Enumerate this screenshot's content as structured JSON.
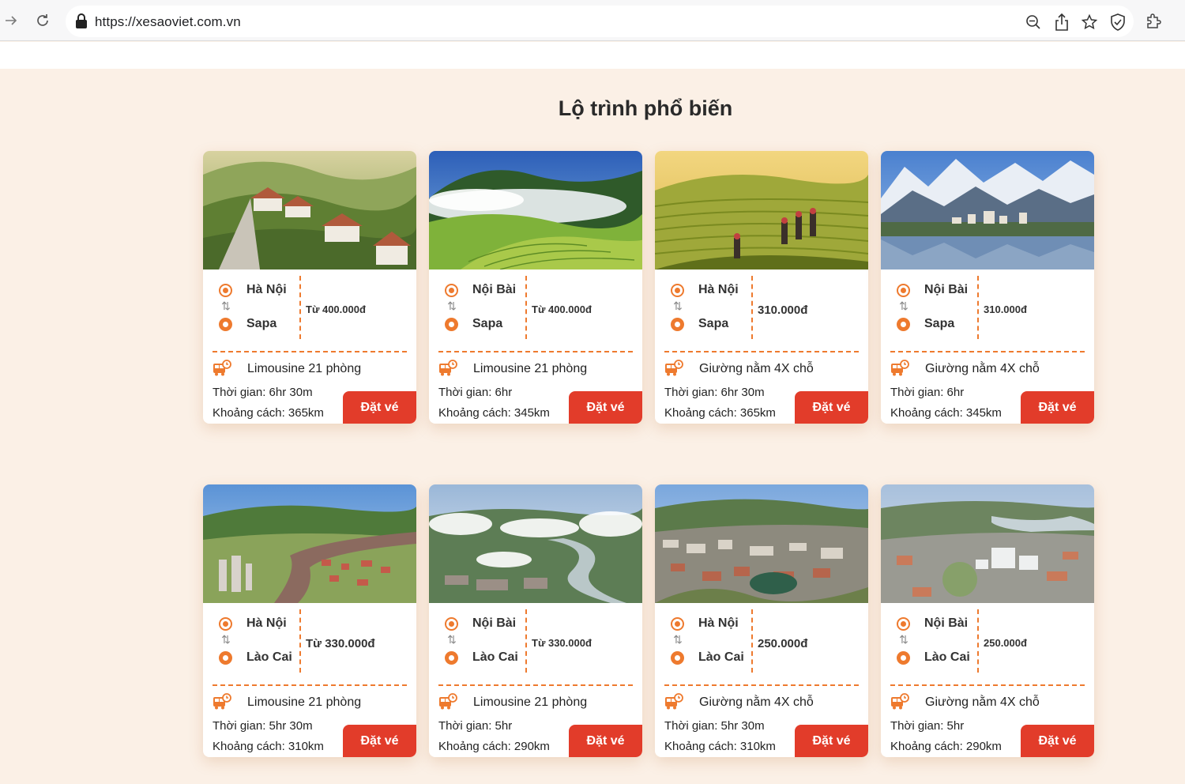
{
  "browser": {
    "url": "https://xesaoviet.com.vn",
    "icons": [
      "forward-icon",
      "reload-icon",
      "lock-icon",
      "zoom-out-icon",
      "share-icon",
      "bookmark-star-icon",
      "shield-icon",
      "extensions-icon"
    ]
  },
  "section": {
    "title": "Lộ trình phổ biến"
  },
  "colors": {
    "accent": "#ee7a2e",
    "button": "#e23c2a",
    "page_bg": "#fbf0e6"
  },
  "cards": [
    {
      "image": "mountain village with red-roof houses",
      "from": "Hà Nội",
      "to": "Sapa",
      "price": "Từ 400.000đ",
      "bus_type": "Limousine 21 phòng",
      "time": "Thời gian: 6hr 30m",
      "distance": "Khoảng cách: 365km",
      "button": "Đặt vé"
    },
    {
      "image": "misty green rice terraces",
      "from": "Nội Bài",
      "to": "Sapa",
      "price": "Từ 400.000đ",
      "bus_type": "Limousine 21 phòng",
      "time": "Thời gian: 6hr",
      "distance": "Khoảng cách: 345km",
      "button": "Đặt vé"
    },
    {
      "image": "golden rice terraces with hikers",
      "from": "Hà Nội",
      "to": "Sapa",
      "price": "310.000đ",
      "bus_type": "Giường nằm 4X chỗ",
      "time": "Thời gian: 6hr 30m",
      "distance": "Khoảng cách: 365km",
      "button": "Đặt vé"
    },
    {
      "image": "snowy mountains above lake town",
      "from": "Nội Bài",
      "to": "Sapa",
      "price": "310.000đ",
      "bus_type": "Giường nằm 4X chỗ",
      "time": "Thời gian: 6hr",
      "distance": "Khoảng cách: 345km",
      "button": "Đặt vé"
    },
    {
      "image": "aerial city with river",
      "from": "Hà Nội",
      "to": "Lào Cai",
      "price": "Từ 330.000đ",
      "bus_type": "Limousine 21 phòng",
      "time": "Thời gian: 5hr 30m",
      "distance": "Khoảng cách: 310km",
      "button": "Đặt vé"
    },
    {
      "image": "aerial city with clouds",
      "from": "Nội Bài",
      "to": "Lào Cai",
      "price": "Từ 330.000đ",
      "bus_type": "Limousine 21 phòng",
      "time": "Thời gian: 5hr",
      "distance": "Khoảng cách: 290km",
      "button": "Đặt vé"
    },
    {
      "image": "aerial dense city",
      "from": "Hà Nội",
      "to": "Lào Cai",
      "price": "250.000đ",
      "bus_type": "Giường nằm 4X chỗ",
      "time": "Thời gian: 5hr 30m",
      "distance": "Khoảng cách: 310km",
      "button": "Đặt vé"
    },
    {
      "image": "aerial city with river bend",
      "from": "Nội Bài",
      "to": "Lào Cai",
      "price": "250.000đ",
      "bus_type": "Giường nằm 4X chỗ",
      "time": "Thời gian: 5hr",
      "distance": "Khoảng cách: 290km",
      "button": "Đặt vé"
    }
  ]
}
